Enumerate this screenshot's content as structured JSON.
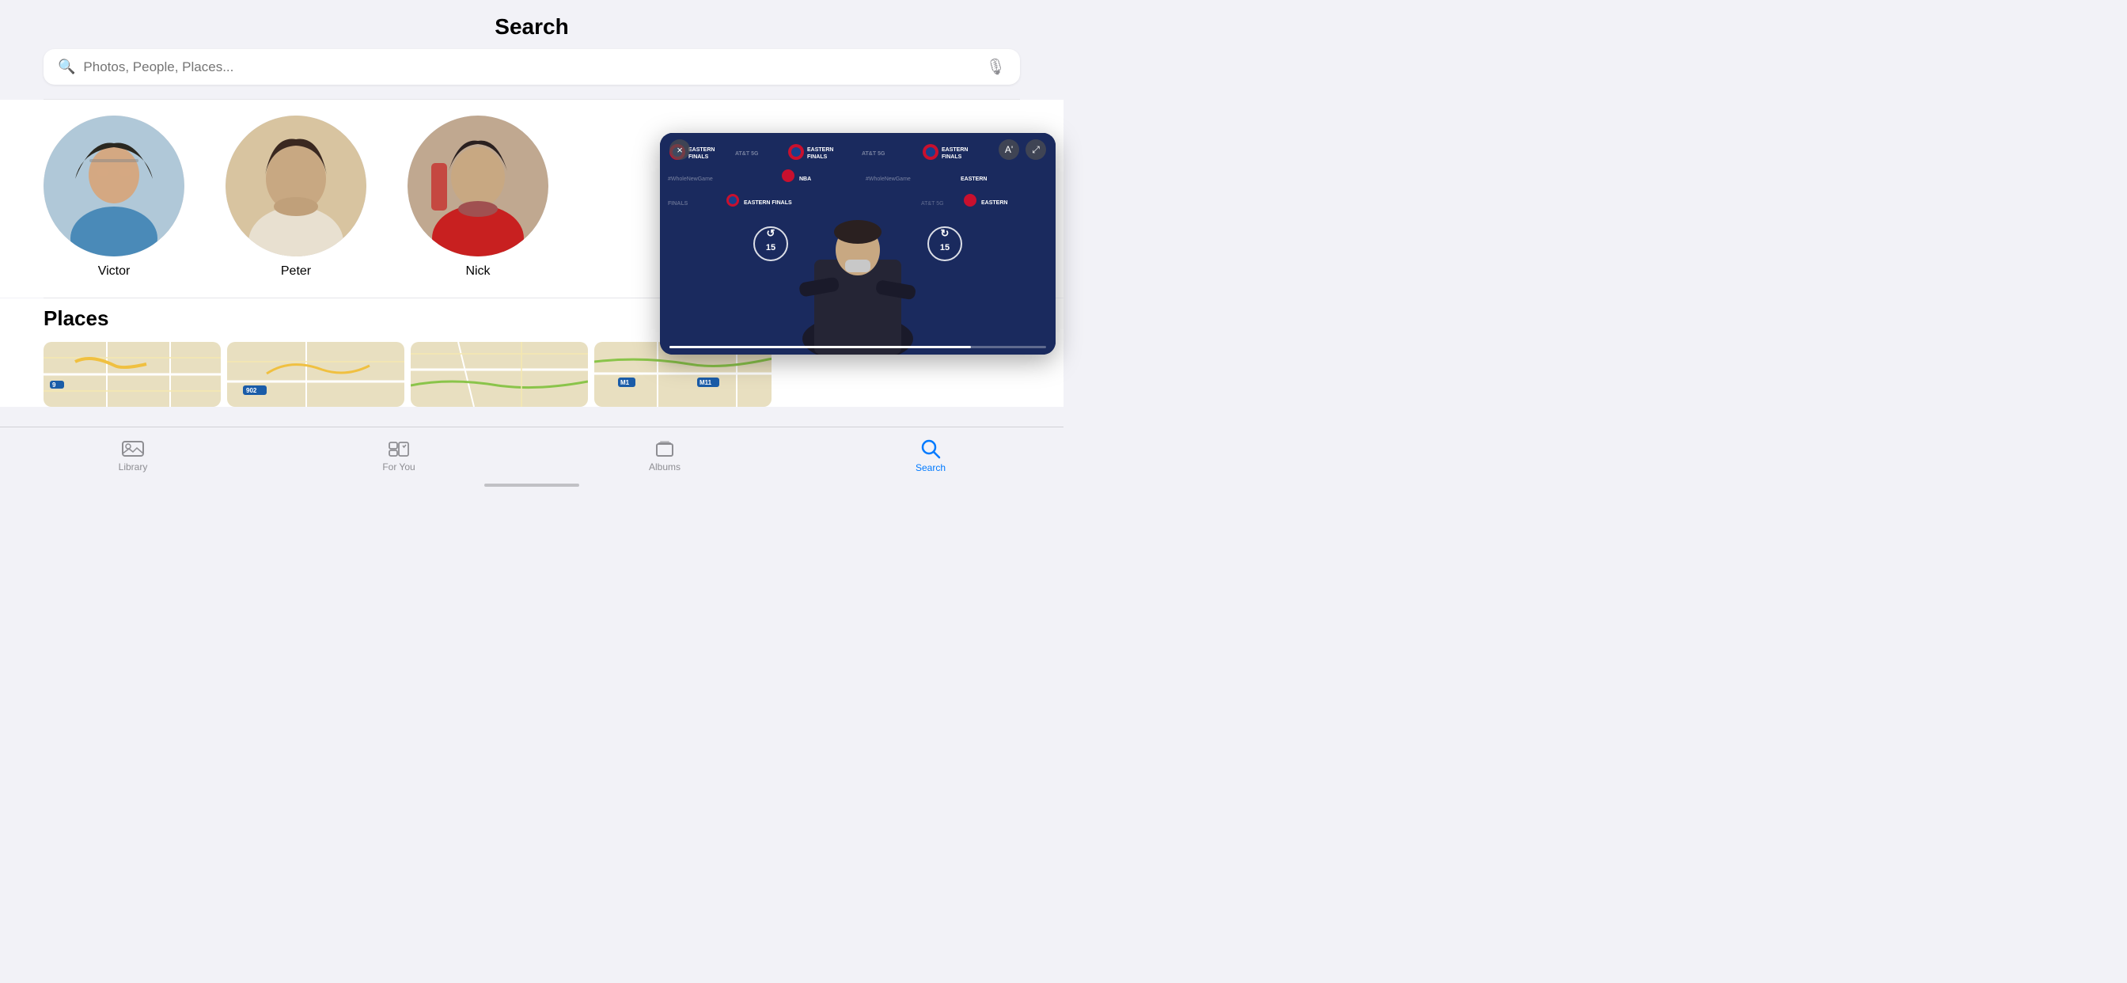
{
  "header": {
    "title": "Search"
  },
  "search_bar": {
    "placeholder": "Photos, People, Places..."
  },
  "people": [
    {
      "name": "Victor",
      "avatar_bg": "#b8c8d8"
    },
    {
      "name": "Peter",
      "avatar_bg": "#d4c0a0"
    },
    {
      "name": "Nick",
      "avatar_bg": "#a8b8c8"
    }
  ],
  "places": {
    "title": "Places",
    "maps": [
      {
        "label": "9"
      },
      {
        "label": "902"
      },
      {},
      {
        "label": "M1",
        "label2": "M11"
      }
    ]
  },
  "pip": {
    "title": "NBA Eastern Finals",
    "replay_left": "15",
    "replay_right": "15",
    "at_and_t": "AT&T 5G",
    "hashtag": "#WholeNewGame",
    "close_label": "×",
    "font_size_label": "A'",
    "expand_label": "⤢"
  },
  "tab_bar": {
    "tabs": [
      {
        "id": "library",
        "label": "Library",
        "icon": "🖼",
        "active": false
      },
      {
        "id": "for-you",
        "label": "For You",
        "icon": "♥",
        "active": false
      },
      {
        "id": "albums",
        "label": "Albums",
        "icon": "▤",
        "active": false
      },
      {
        "id": "search",
        "label": "Search",
        "icon": "🔍",
        "active": true
      }
    ]
  },
  "colors": {
    "accent": "#007aff",
    "inactive": "#8e8e93",
    "bg": "#f2f2f7"
  }
}
